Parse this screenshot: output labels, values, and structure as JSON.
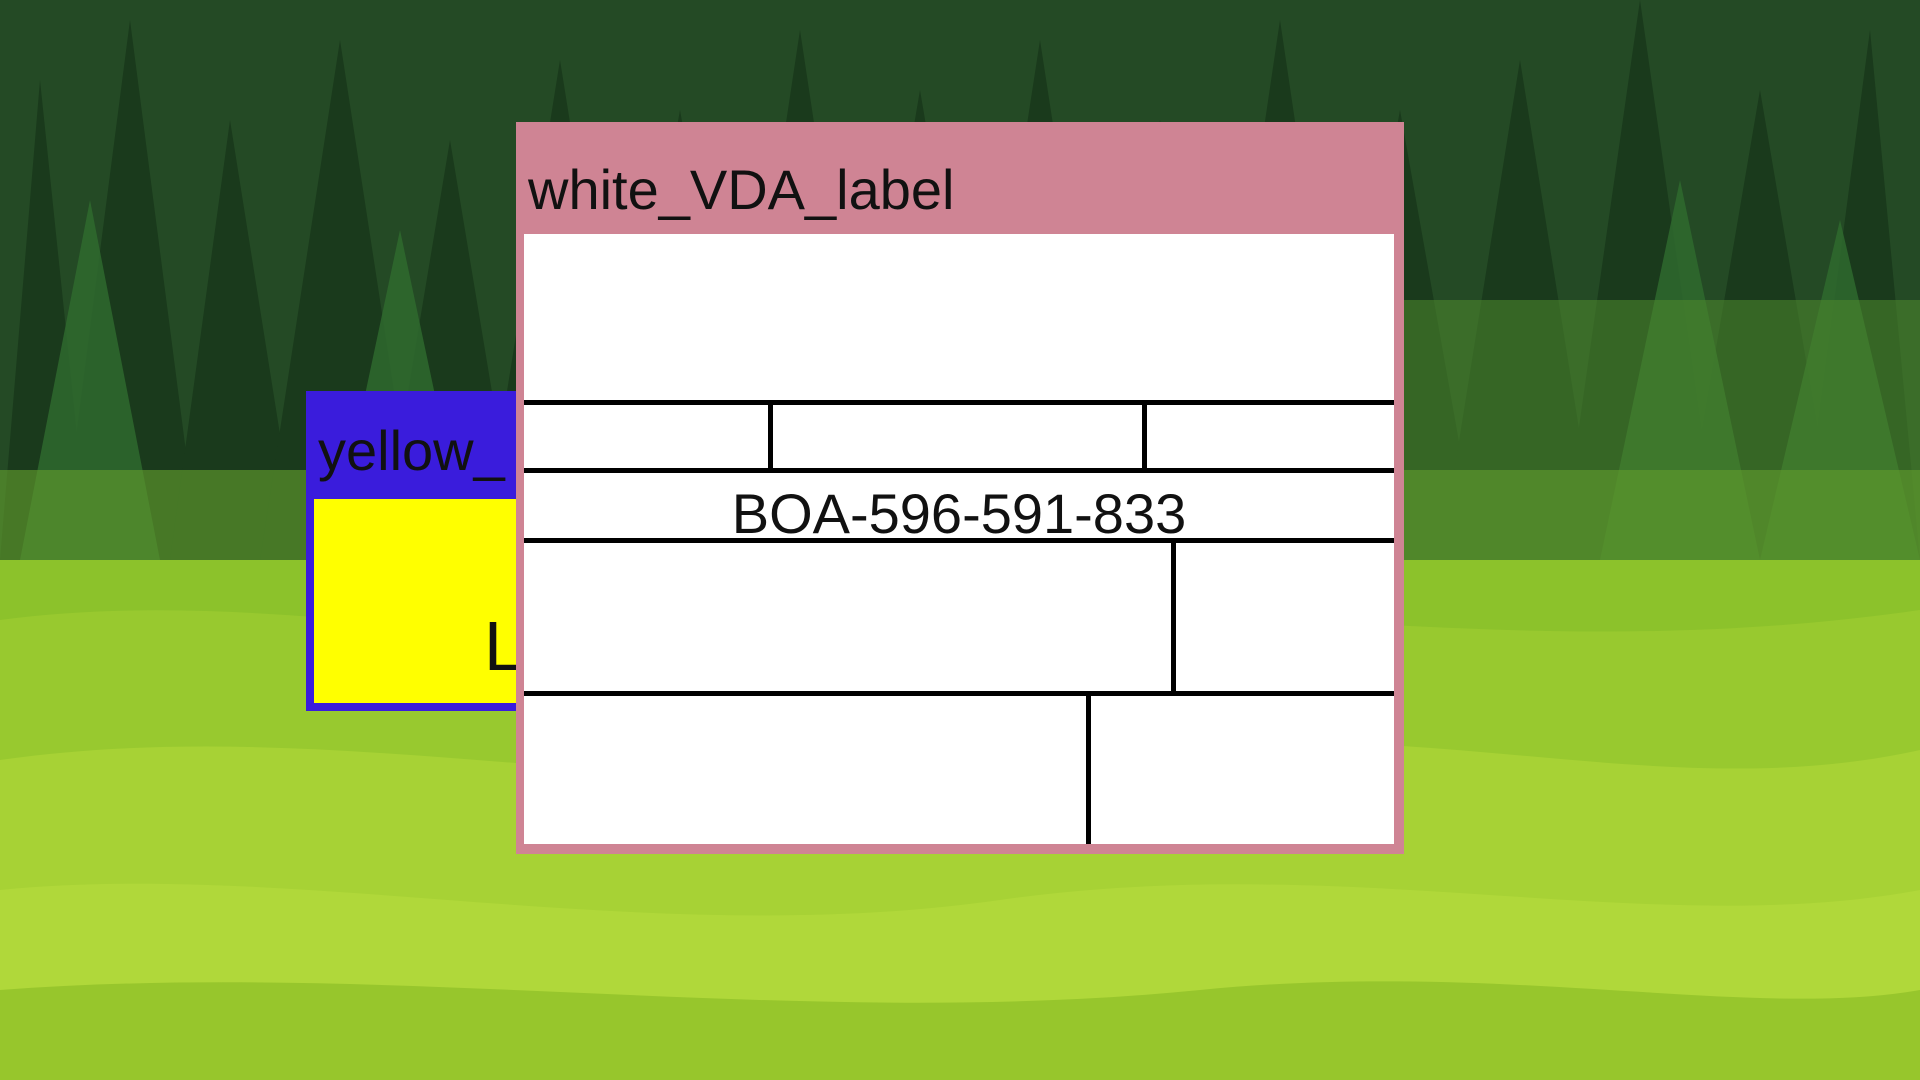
{
  "desktop": {
    "wallpaper": "forest-meadow"
  },
  "windows": {
    "yellow": {
      "title": "yellow_",
      "body_text": "L",
      "frame_color": "#3a1cdc",
      "body_color": "#ffff00"
    },
    "white": {
      "title": "white_VDA_label",
      "frame_color": "#cf8494",
      "body_color": "#ffffff",
      "code": "BOA-596-591-833"
    }
  }
}
